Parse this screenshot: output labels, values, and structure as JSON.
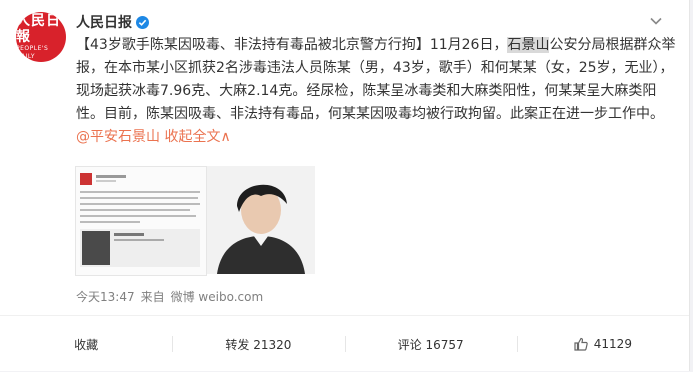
{
  "post": {
    "author": "人民日报",
    "avatar_text_cn": "人民日報",
    "avatar_text_en": "PEOPLE'S DAILY",
    "body_part1": "【43岁歌手陈某因吸毒、非法持有毒品被北京警方行拘】11月26日，",
    "body_highlight": "石景山",
    "body_part2": "公安分局根据群众举报，在本市某小区抓获2名涉毒违法人员陈某（男，43岁，歌手）和何某某（女，25岁，无业），现场起获冰毒7.96克、大麻2.14克。经尿检，陈某呈冰毒类和大麻类阳性，何某某呈大麻类阳性。目前，陈某因吸毒、非法持有毒品，何某某因吸毒均被行政拘留。此案正在进一步工作中。",
    "mention": "@平安石景山",
    "expand_label": "收起全文",
    "expand_arrow": "∧",
    "time": "今天13:47",
    "source_prefix": "来自",
    "source": "微博 weibo.com"
  },
  "actions": {
    "favorite": "收藏",
    "repost": "转发 21320",
    "comment": "评论 16757",
    "like": "41129"
  }
}
